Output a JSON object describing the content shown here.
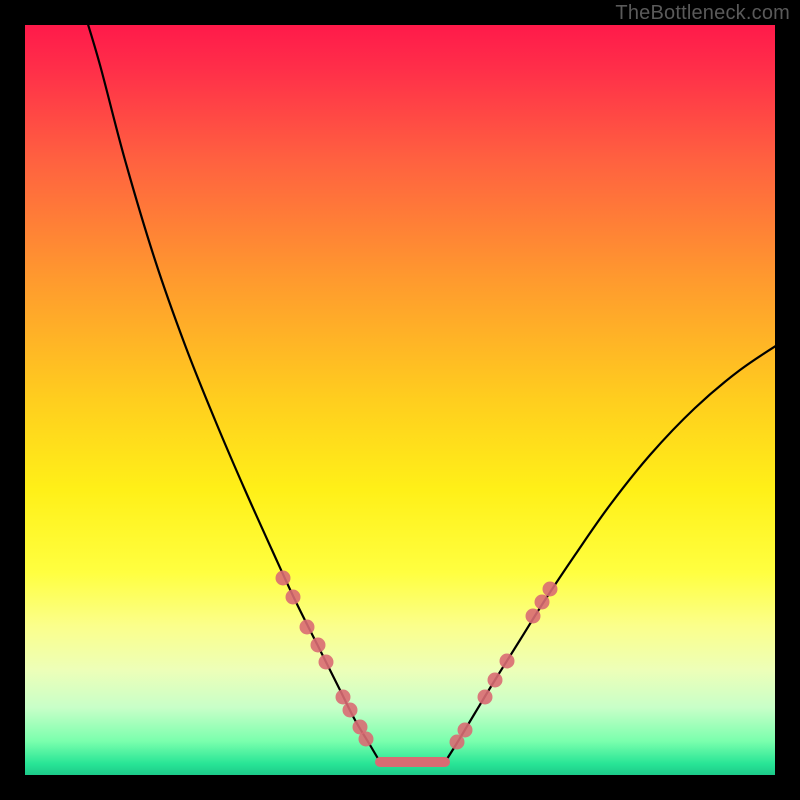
{
  "watermark": "TheBottleneck.com",
  "colors": {
    "gradient_stops": [
      {
        "offset": 0.0,
        "color": "#ff1a4a"
      },
      {
        "offset": 0.06,
        "color": "#ff2f49"
      },
      {
        "offset": 0.18,
        "color": "#ff6140"
      },
      {
        "offset": 0.34,
        "color": "#ff9a2e"
      },
      {
        "offset": 0.5,
        "color": "#ffce1e"
      },
      {
        "offset": 0.62,
        "color": "#fff018"
      },
      {
        "offset": 0.73,
        "color": "#ffff40"
      },
      {
        "offset": 0.8,
        "color": "#fbff8a"
      },
      {
        "offset": 0.86,
        "color": "#edffb8"
      },
      {
        "offset": 0.91,
        "color": "#c8ffc8"
      },
      {
        "offset": 0.955,
        "color": "#7affad"
      },
      {
        "offset": 0.985,
        "color": "#28e596"
      },
      {
        "offset": 1.0,
        "color": "#1cc989"
      }
    ],
    "frame": "#000000",
    "curve": "#000000",
    "dot": "#d96b73"
  },
  "chart_data": {
    "type": "line",
    "title": "",
    "xlabel": "",
    "ylabel": "",
    "x_range": [
      0,
      750
    ],
    "y_range_note": "y=0 is top of plot area, y=750 is bottom",
    "series": [
      {
        "name": "left_curve",
        "points": [
          [
            57,
            -20
          ],
          [
            75,
            40
          ],
          [
            100,
            135
          ],
          [
            130,
            235
          ],
          [
            160,
            320
          ],
          [
            190,
            395
          ],
          [
            220,
            465
          ],
          [
            247,
            525
          ],
          [
            270,
            575
          ],
          [
            295,
            625
          ],
          [
            315,
            665
          ],
          [
            330,
            695
          ],
          [
            345,
            720
          ],
          [
            355,
            737
          ]
        ]
      },
      {
        "name": "right_curve",
        "points": [
          [
            420,
            737
          ],
          [
            432,
            718
          ],
          [
            450,
            688
          ],
          [
            470,
            655
          ],
          [
            495,
            615
          ],
          [
            520,
            575
          ],
          [
            550,
            530
          ],
          [
            585,
            480
          ],
          [
            625,
            430
          ],
          [
            670,
            383
          ],
          [
            715,
            345
          ],
          [
            760,
            315
          ]
        ]
      },
      {
        "name": "bottom_min_segment",
        "points": [
          [
            355,
            737
          ],
          [
            420,
            737
          ]
        ]
      }
    ],
    "dots_left": [
      [
        258,
        553
      ],
      [
        268,
        572
      ],
      [
        282,
        602
      ],
      [
        293,
        620
      ],
      [
        301,
        637
      ],
      [
        318,
        672
      ],
      [
        325,
        685
      ],
      [
        335,
        702
      ],
      [
        341,
        714
      ]
    ],
    "dots_right": [
      [
        432,
        717
      ],
      [
        440,
        705
      ],
      [
        460,
        672
      ],
      [
        470,
        655
      ],
      [
        482,
        636
      ],
      [
        508,
        591
      ],
      [
        517,
        577
      ],
      [
        525,
        564
      ]
    ],
    "interpretation": "V-shaped bottleneck curve; minimum (best match) near x≈355–420 at the bottom green band; pink dots mark nearby sample points along the curve."
  }
}
